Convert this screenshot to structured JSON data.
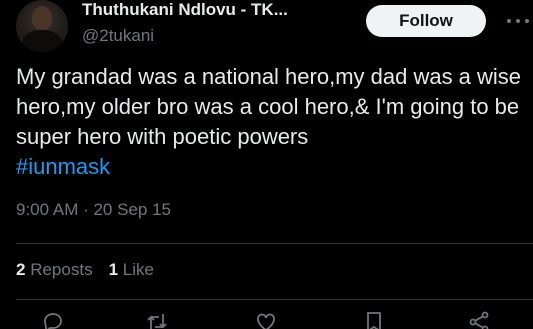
{
  "author": {
    "display_name": "Thuthukani Ndlovu - TK...",
    "handle": "@2tukani"
  },
  "follow_button": {
    "label": "Follow"
  },
  "tweet": {
    "text": "My grandad was a national hero,my dad was a wise hero,my older bro was a cool hero,& I'm going to be super hero with poetic powers",
    "hashtag": "#iunmask",
    "timestamp": "9:00 AM · 20 Sep 15"
  },
  "stats": {
    "reposts_count": "2",
    "reposts_label": "Reposts",
    "likes_count": "1",
    "likes_label": "Like"
  },
  "icons": {
    "reply": "reply-icon",
    "repost": "repost-icon",
    "like": "heart-icon",
    "bookmark": "bookmark-icon",
    "share": "share-icon",
    "more": "more-icon"
  },
  "colors": {
    "background": "#000000",
    "text": "#e7e9ea",
    "muted": "#71767b",
    "link": "#1d9bf0",
    "follow_bg": "#eff3f4"
  }
}
